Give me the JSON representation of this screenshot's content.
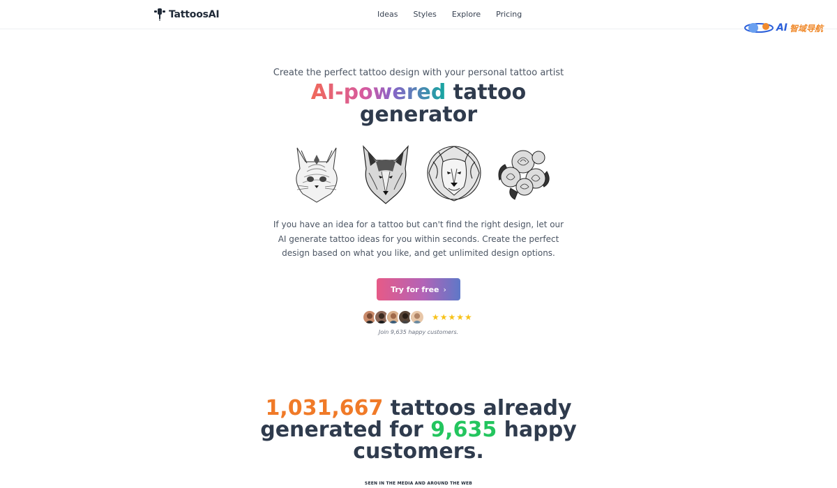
{
  "header": {
    "logo_text": "TattoosAI",
    "nav": [
      "Ideas",
      "Styles",
      "Explore",
      "Pricing"
    ]
  },
  "watermark": {
    "ai": "AI",
    "cn": "智域导航"
  },
  "hero": {
    "subtitle": "Create the perfect tattoo design with your personal tattoo artist",
    "title_gradient": "AI-powered",
    "title_rest": " tattoo",
    "title_line2": "generator",
    "gallery": [
      {
        "name": "cat-tattoo"
      },
      {
        "name": "wolf-tattoo"
      },
      {
        "name": "lion-tattoo"
      },
      {
        "name": "roses-tattoo"
      }
    ],
    "description": "If you have an idea for a tattoo but can't find the right design, let our AI generate tattoo ideas for you within seconds. Create the perfect design based on what you like, and get unlimited design options.",
    "cta_label": "Try for free",
    "rating_stars": "★★★★★",
    "happy_text": "Join 9,635 happy customers."
  },
  "stats": {
    "tattoos_count": "1,031,667",
    "text1": " tattoos already generated for ",
    "customers_count": "9,635",
    "text2": " happy customers."
  },
  "seen_in": "SEEN IN THE MEDIA AND AROUND THE WEB",
  "colors": {
    "accent_orange": "#f07a28",
    "accent_green": "#23c55e",
    "cta_start": "#e65a87",
    "cta_end": "#5e78c8"
  }
}
